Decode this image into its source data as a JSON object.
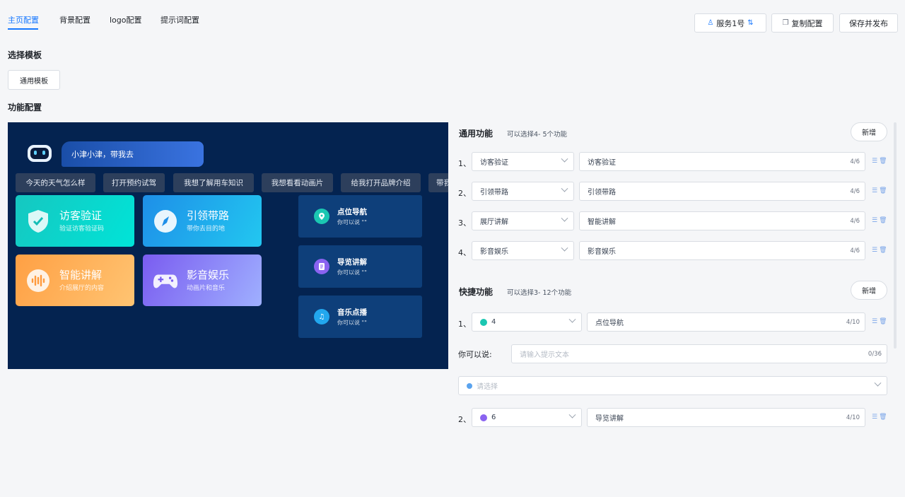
{
  "tabs": [
    {
      "label": "主页配置",
      "active": true
    },
    {
      "label": "背景配置",
      "active": false
    },
    {
      "label": "logo配置",
      "active": false
    },
    {
      "label": "提示词配置",
      "active": false
    }
  ],
  "actions": {
    "service": "服务1号",
    "copy": "复制配置",
    "save": "保存并发布"
  },
  "template_section": {
    "title": "选择模板",
    "button": "通用模板"
  },
  "function_section_title": "功能配置",
  "preview": {
    "greeting": "小津小津，带我去",
    "chips": [
      "今天的天气怎么样",
      "打开预约试驾",
      "我想了解用车知识",
      "我想看看动画片",
      "给我打开品牌介绍",
      "带我"
    ],
    "cards": [
      {
        "title": "访客验证",
        "sub": "验证访客验证码",
        "icon": "shield-check-icon",
        "color_from": "#16c7c0",
        "color_to": "#00e4d8"
      },
      {
        "title": "引领带路",
        "sub": "带你去目的地",
        "icon": "compass-icon",
        "color_from": "#1e8fe8",
        "color_to": "#22c7f0"
      },
      {
        "title": "智能讲解",
        "sub": "介绍展厅的内容",
        "icon": "audio-wave-icon",
        "color_from": "#ffa044",
        "color_to": "#ffc472"
      },
      {
        "title": "影音娱乐",
        "sub": "动画片和音乐",
        "icon": "gamepad-icon",
        "color_from": "#7a5cf0",
        "color_to": "#9fb0ff"
      }
    ],
    "quick": [
      {
        "title": "点位导航",
        "sub": "你可以说 \"\"",
        "icon": "location-pin-icon",
        "color": "#1bc7b2"
      },
      {
        "title": "导览讲解",
        "sub": "你可以说 \"\"",
        "icon": "document-icon",
        "color": "#8a63f0"
      },
      {
        "title": "音乐点播",
        "sub": "你可以说 \"\"",
        "icon": "music-note-icon",
        "color": "#22a7ee"
      }
    ]
  },
  "general": {
    "title": "通用功能",
    "hint": "可以选择4- 5个功能",
    "add": "新增",
    "rows": [
      {
        "num": "1、",
        "select": "访客验证",
        "value": "访客验证",
        "count": "4/6"
      },
      {
        "num": "2、",
        "select": "引领带路",
        "value": "引领带路",
        "count": "4/6"
      },
      {
        "num": "3、",
        "select": "展厅讲解",
        "value": "智能讲解",
        "count": "4/6"
      },
      {
        "num": "4、",
        "select": "影音娱乐",
        "value": "影音娱乐",
        "count": "4/6"
      }
    ]
  },
  "shortcut": {
    "title": "快捷功能",
    "hint": "可以选择3- 12个功能",
    "add": "新增",
    "rows": [
      {
        "num": "1、",
        "select": "4",
        "value": "点位导航",
        "count": "4/10",
        "dot": "#1bc7b2"
      },
      {
        "num": "2、",
        "select": "6",
        "value": "导览讲解",
        "count": "4/10",
        "dot": "#8a63f0"
      }
    ],
    "say_label": "你可以说:",
    "say_placeholder": "请输入提示文本",
    "say_count": "0/36",
    "choose_placeholder": "请选择"
  }
}
